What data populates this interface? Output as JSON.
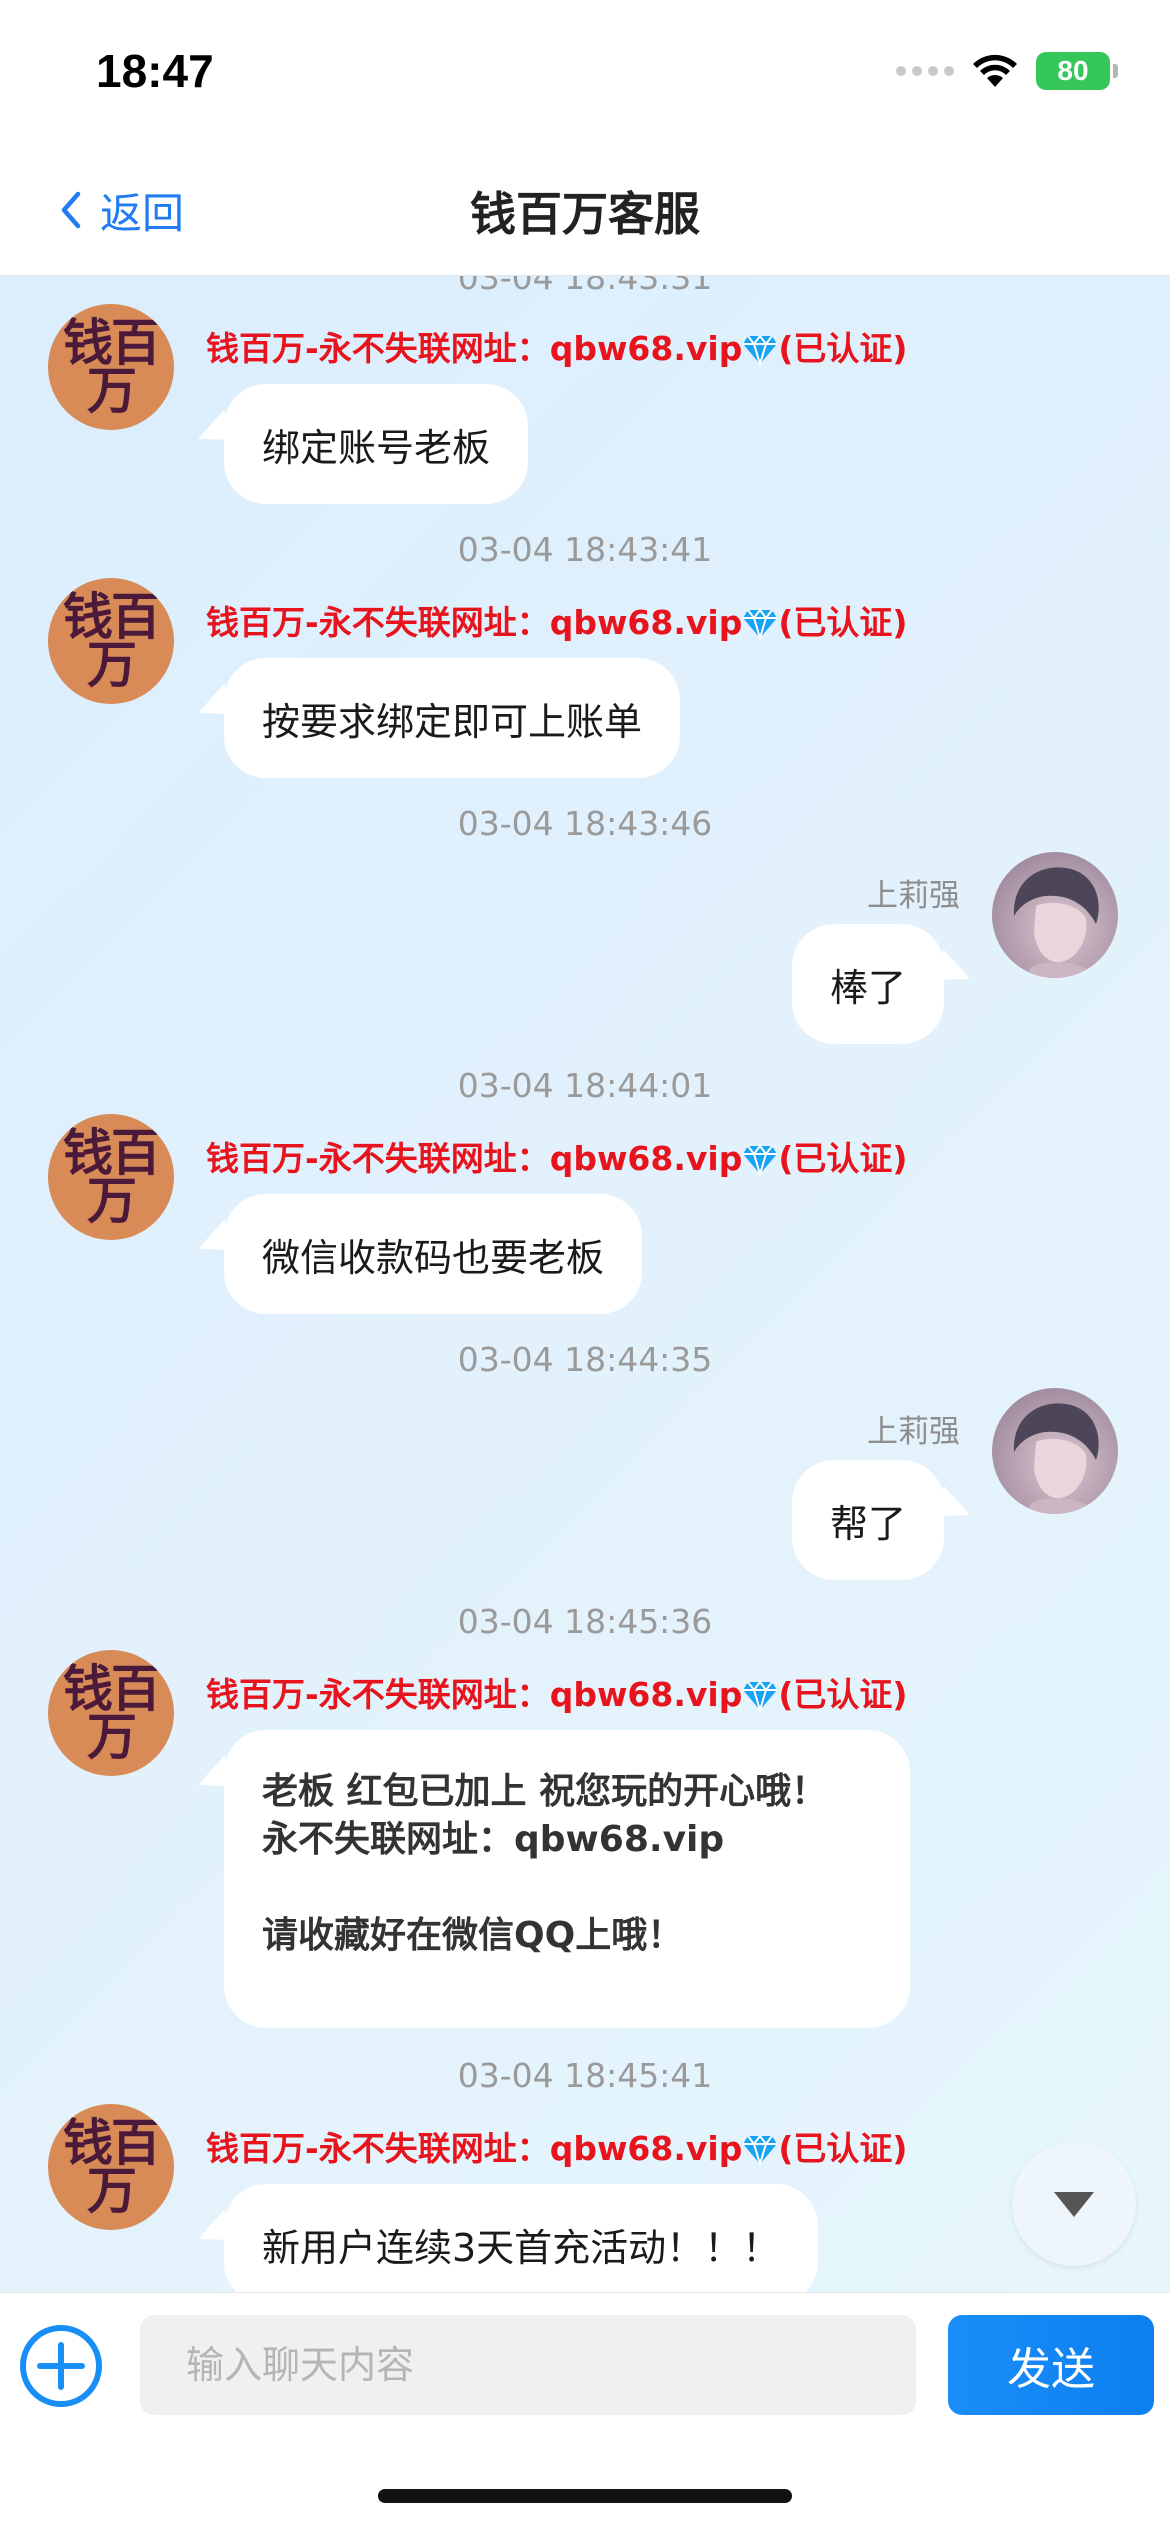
{
  "status_bar": {
    "time": "18:47",
    "battery": "80"
  },
  "nav": {
    "back_label": "返回",
    "title": "钱百万客服"
  },
  "avatar_logo": [
    "钱百",
    "万"
  ],
  "sender_name_left": "钱百万-永不失联网址：qbw68.vip",
  "sender_verified": "(已认证)",
  "sender_name_right": "上莉强",
  "top_partial_timestamp": "03-04 18:43:31",
  "messages": [
    {
      "side": "left",
      "text": "绑定账号老板"
    },
    {
      "timestamp": "03-04 18:43:41",
      "side": "left",
      "text": "按要求绑定即可上账单"
    },
    {
      "timestamp": "03-04 18:43:46",
      "side": "right",
      "text": "棒了"
    },
    {
      "timestamp": "03-04 18:44:01",
      "side": "left",
      "text": "微信收款码也要老板"
    },
    {
      "timestamp": "03-04 18:44:35",
      "side": "right",
      "text": "帮了"
    },
    {
      "timestamp": "03-04 18:45:36",
      "side": "left",
      "lines": [
        "老板 红包已加上 祝您玩的开心哦！",
        "永不失联网址：qbw68.vip",
        "",
        "请收藏好在微信QQ上哦！"
      ]
    },
    {
      "timestamp": "03-04 18:45:41",
      "side": "left",
      "text": "新用户连续3天首充活动！！！"
    }
  ],
  "input": {
    "placeholder": "输入聊天内容",
    "value": ""
  },
  "send_label": "发送",
  "colors": {
    "accent": "#1f7cf1",
    "sender_red": "#e8141d",
    "send_button": "#0c7ff0"
  }
}
